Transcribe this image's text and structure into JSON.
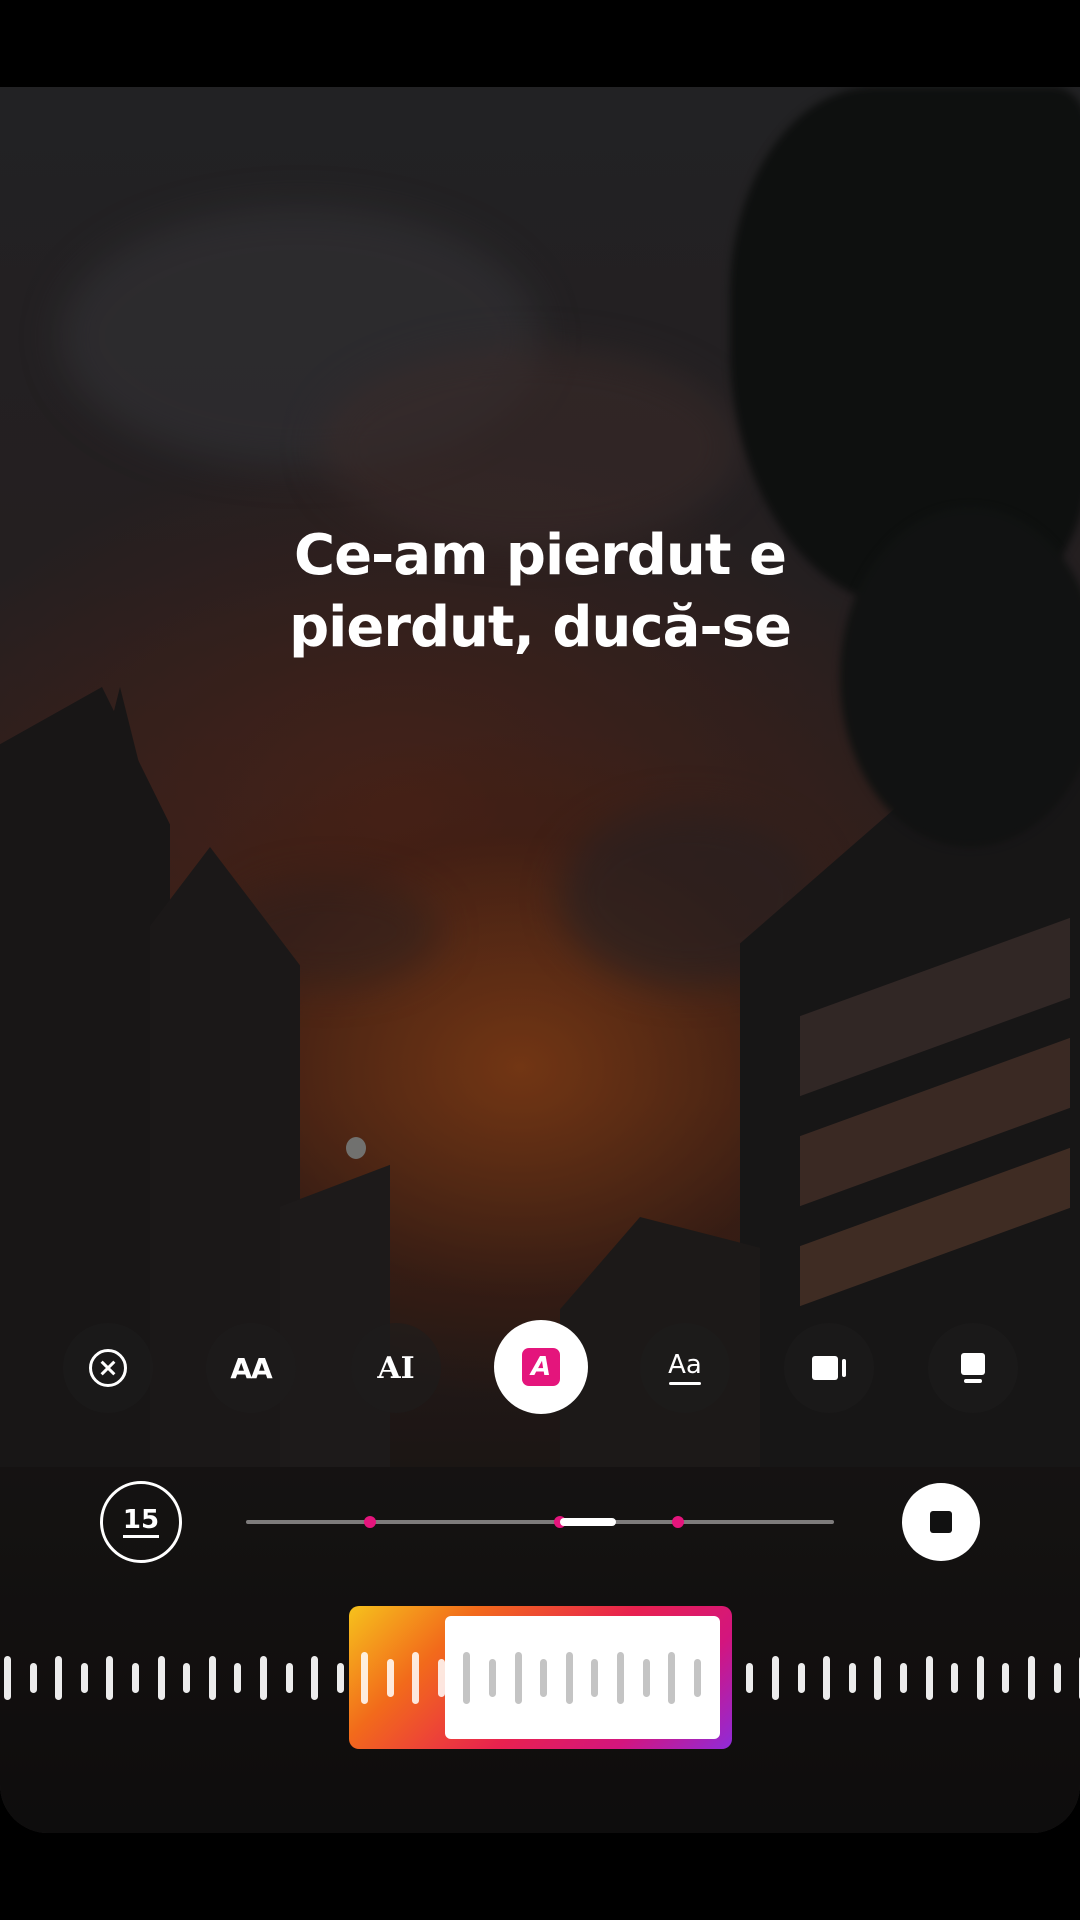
{
  "lyrics": {
    "line1": "Ce-am pierdut e",
    "line2": "pierdut, ducă-se"
  },
  "style_toolbar": {
    "items": [
      {
        "name": "close-style-icon",
        "glyph": "",
        "active": false
      },
      {
        "name": "style-small-caps-icon",
        "glyph": "AA",
        "active": false
      },
      {
        "name": "style-typewriter-icon",
        "glyph": "AI",
        "active": false
      },
      {
        "name": "style-highlight-icon",
        "glyph": "A",
        "active": true
      },
      {
        "name": "style-underline-icon",
        "glyph": "Aa",
        "active": false
      },
      {
        "name": "style-box-right-icon",
        "glyph": "",
        "active": false
      },
      {
        "name": "style-box-top-icon",
        "glyph": "",
        "active": false
      }
    ]
  },
  "timeline": {
    "duration_label": "15",
    "position": 0.55,
    "markers": [
      0.21,
      0.54,
      0.74
    ]
  },
  "colors": {
    "accent": "#e4157c",
    "gradient_start": "#f6c21c",
    "gradient_end": "#8f2bd9"
  }
}
